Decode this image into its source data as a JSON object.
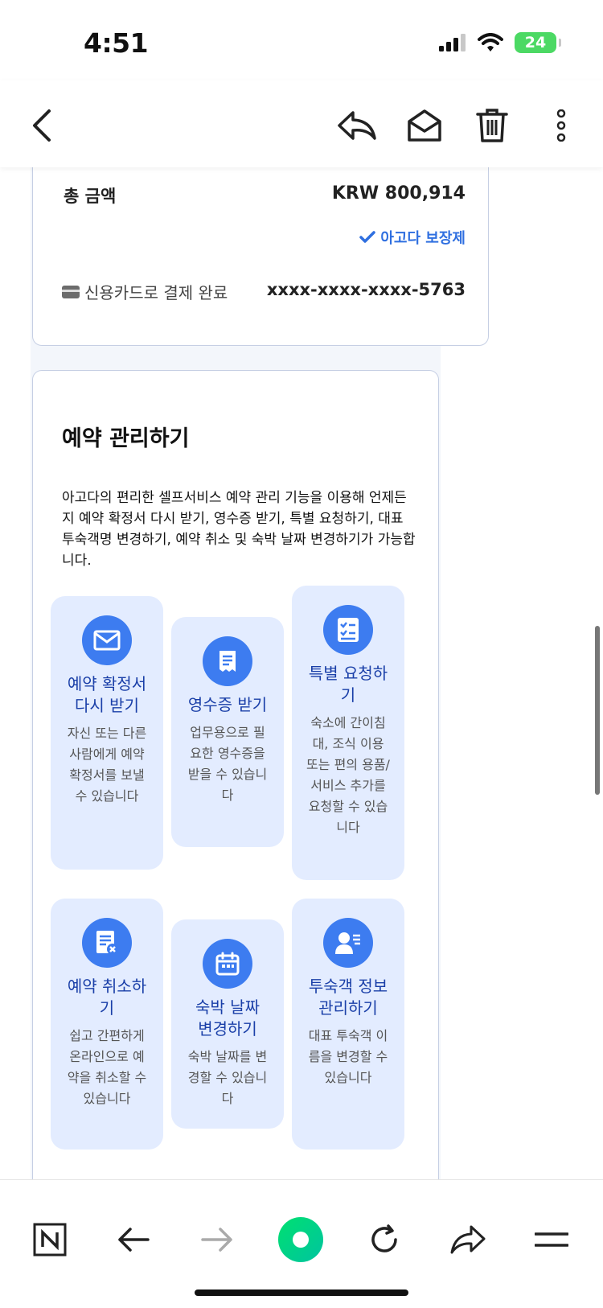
{
  "status": {
    "time": "4:51",
    "battery": "24"
  },
  "booking": {
    "total_label": "총 금액",
    "total_value": "KRW 800,914",
    "guarantee": "아고다 보장제",
    "payment_label": "신용카드로 결제 완료",
    "card_number": "xxxx-xxxx-xxxx-5763"
  },
  "manage": {
    "title": "예약 관리하기",
    "description": "아고다의 편리한 셀프서비스 예약 관리 기능을 이용해 언제든지 예약 확정서 다시 받기, 영수증 받기, 특별 요청하기, 대표 투숙객명 변경하기, 예약 취소 및 숙박 날짜 변경하기가 가능합니다.",
    "tiles": [
      {
        "icon": "envelope-icon",
        "title": "예약 확정서 다시 받기",
        "desc": "자신 또는 다른 사람에게 예약 확정서를 보낼 수 있습니다"
      },
      {
        "icon": "receipt-icon",
        "title": "영수증 받기",
        "desc": "업무용으로 필요한 영수증을 받을 수 있습니다"
      },
      {
        "icon": "checklist-icon",
        "title": "특별 요청하기",
        "desc": "숙소에 간이침대, 조식 이용 또는 편의 용품/서비스 추가를 요청할 수 있습니다"
      },
      {
        "icon": "cancel-document-icon",
        "title": "예약 취소하기",
        "desc": "쉽고 간편하게 온라인으로 예약을 취소할 수 있습니다"
      },
      {
        "icon": "calendar-icon",
        "title": "숙박 날짜 변경하기",
        "desc": "숙박 날짜를 변경할 수 있습니다"
      },
      {
        "icon": "guest-profile-icon",
        "title": "투숙객 정보 관리하기",
        "desc": "대표 투숙객 이름을 변경할 수 있습니다"
      }
    ]
  },
  "colors": {
    "accent": "#3d7cf0",
    "tile_bg": "#e3ecff",
    "link": "#2f6fe0",
    "tile_title": "#1a3fa8"
  }
}
